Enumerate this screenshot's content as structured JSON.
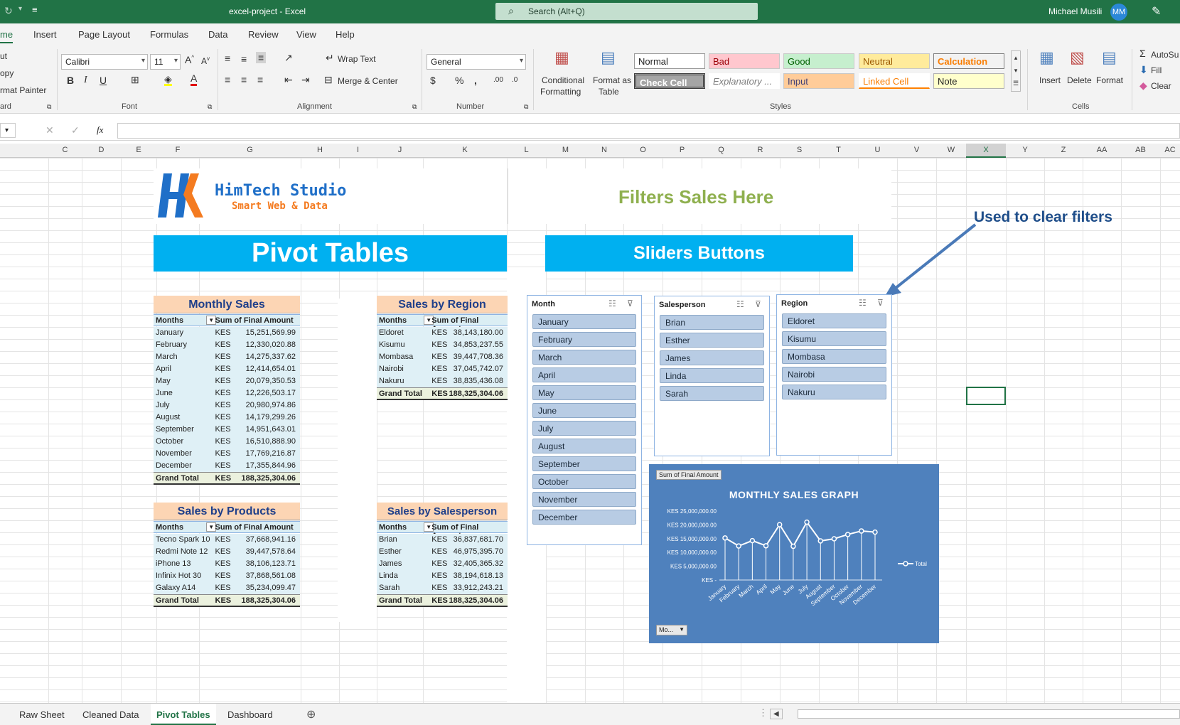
{
  "app": {
    "doc_title": "excel-project  -  Excel",
    "search_placeholder": "Search (Alt+Q)",
    "user_name": "Michael Musili",
    "user_initials": "MM"
  },
  "ribbon_tabs": [
    "me",
    "Insert",
    "Page Layout",
    "Formulas",
    "Data",
    "Review",
    "View",
    "Help"
  ],
  "ribbon": {
    "clipboard": {
      "cut": "ut",
      "copy": "opy",
      "format_painter": "rmat Painter",
      "label": "ard"
    },
    "font": {
      "name": "Calibri",
      "size": "11",
      "label": "Font"
    },
    "alignment": {
      "wrap": "Wrap Text",
      "merge": "Merge & Center",
      "label": "Alignment"
    },
    "number": {
      "format": "General",
      "label": "Number"
    },
    "styles": {
      "conditional": "Conditional",
      "conditional2": "Formatting",
      "format_as": "Format as",
      "format_as2": "Table",
      "normal": "Normal",
      "bad": "Bad",
      "good": "Good",
      "neutral": "Neutral",
      "calculation": "Calculation",
      "check_cell": "Check Cell",
      "explanatory": "Explanatory ...",
      "input": "Input",
      "linked_cell": "Linked Cell",
      "note": "Note",
      "label": "Styles"
    },
    "cells": {
      "insert": "Insert",
      "delete": "Delete",
      "format": "Format",
      "label": "Cells"
    },
    "editing": {
      "autosum": "AutoSu",
      "fill": "Fill",
      "clear": "Clear"
    }
  },
  "formula_bar": {
    "cancel": "✕",
    "enter": "✓",
    "fx": "fx",
    "content": ""
  },
  "columns": [
    "C",
    "D",
    "E",
    "F",
    "G",
    "H",
    "I",
    "J",
    "K",
    "L",
    "M",
    "N",
    "O",
    "P",
    "Q",
    "R",
    "S",
    "T",
    "U",
    "V",
    "W",
    "X",
    "Y",
    "Z",
    "AA",
    "AB",
    "AC"
  ],
  "logo": {
    "title": "HimTech Studio",
    "subtitle": "Smart Web & Data"
  },
  "filters_heading": "Filters Sales Here",
  "clear_note": "Used to clear filters",
  "pivot_banner": "Pivot Tables",
  "sliders_banner": "Sliders Buttons",
  "monthly_sales": {
    "title": "Monthly Sales",
    "col1": "Months",
    "col2": "Sum of Final Amount",
    "rows": [
      {
        "name": "January",
        "cur": "KES",
        "amt": "15,251,569.99"
      },
      {
        "name": "February",
        "cur": "KES",
        "amt": "12,330,020.88"
      },
      {
        "name": "March",
        "cur": "KES",
        "amt": "14,275,337.62"
      },
      {
        "name": "April",
        "cur": "KES",
        "amt": "12,414,654.01"
      },
      {
        "name": "May",
        "cur": "KES",
        "amt": "20,079,350.53"
      },
      {
        "name": "June",
        "cur": "KES",
        "amt": "12,226,503.17"
      },
      {
        "name": "July",
        "cur": "KES",
        "amt": "20,980,974.86"
      },
      {
        "name": "August",
        "cur": "KES",
        "amt": "14,179,299.26"
      },
      {
        "name": "September",
        "cur": "KES",
        "amt": "14,951,643.01"
      },
      {
        "name": "October",
        "cur": "KES",
        "amt": "16,510,888.90"
      },
      {
        "name": "November",
        "cur": "KES",
        "amt": "17,769,216.87"
      },
      {
        "name": "December",
        "cur": "KES",
        "amt": "17,355,844.96"
      }
    ],
    "total": {
      "name": "Grand Total",
      "cur": "KES",
      "amt": "188,325,304.06"
    }
  },
  "sales_region": {
    "title": "Sales by Region",
    "col1": "Months",
    "col2": "Sum of Final Amount",
    "rows": [
      {
        "name": "Eldoret",
        "cur": "KES",
        "amt": "38,143,180.00"
      },
      {
        "name": "Kisumu",
        "cur": "KES",
        "amt": "34,853,237.55"
      },
      {
        "name": "Mombasa",
        "cur": "KES",
        "amt": "39,447,708.36"
      },
      {
        "name": "Nairobi",
        "cur": "KES",
        "amt": "37,045,742.07"
      },
      {
        "name": "Nakuru",
        "cur": "KES",
        "amt": "38,835,436.08"
      }
    ],
    "total": {
      "name": "Grand Total",
      "cur": "KES",
      "amt": "188,325,304.06"
    }
  },
  "sales_products": {
    "title": "Sales by Products",
    "col1": "Months",
    "col2": "Sum of Final Amount",
    "rows": [
      {
        "name": "Tecno Spark 10",
        "cur": "KES",
        "amt": "37,668,941.16"
      },
      {
        "name": "Redmi Note 12",
        "cur": "KES",
        "amt": "39,447,578.64"
      },
      {
        "name": "iPhone 13",
        "cur": "KES",
        "amt": "38,106,123.71"
      },
      {
        "name": "Infinix Hot 30",
        "cur": "KES",
        "amt": "37,868,561.08"
      },
      {
        "name": "Galaxy A14",
        "cur": "KES",
        "amt": "35,234,099.47"
      }
    ],
    "total": {
      "name": "Grand Total",
      "cur": "KES",
      "amt": "188,325,304.06"
    }
  },
  "sales_salesperson": {
    "title": "Sales by Salesperson",
    "col1": "Months",
    "col2": "Sum of Final Amount",
    "rows": [
      {
        "name": "Brian",
        "cur": "KES",
        "amt": "36,837,681.70"
      },
      {
        "name": "Esther",
        "cur": "KES",
        "amt": "46,975,395.70"
      },
      {
        "name": "James",
        "cur": "KES",
        "amt": "32,405,365.32"
      },
      {
        "name": "Linda",
        "cur": "KES",
        "amt": "38,194,618.13"
      },
      {
        "name": "Sarah",
        "cur": "KES",
        "amt": "33,912,243.21"
      }
    ],
    "total": {
      "name": "Grand Total",
      "cur": "KES",
      "amt": "188,325,304.06"
    }
  },
  "slicers": {
    "month": {
      "title": "Month",
      "items": [
        "January",
        "February",
        "March",
        "April",
        "May",
        "June",
        "July",
        "August",
        "September",
        "October",
        "November",
        "December"
      ]
    },
    "salesperson": {
      "title": "Salesperson",
      "items": [
        "Brian",
        "Esther",
        "James",
        "Linda",
        "Sarah"
      ]
    },
    "region": {
      "title": "Region",
      "items": [
        "Eldoret",
        "Kisumu",
        "Mombasa",
        "Nairobi",
        "Nakuru"
      ]
    }
  },
  "chart_data": {
    "type": "line",
    "title": "MONTHLY SALES GRAPH",
    "field_button": "Sum of Final Amount",
    "axis_button": "Mo...",
    "categories": [
      "January",
      "February",
      "March",
      "April",
      "May",
      "June",
      "July",
      "August",
      "September",
      "October",
      "November",
      "December"
    ],
    "series": [
      {
        "name": "Total",
        "values": [
          15251569.99,
          12330020.88,
          14275337.62,
          12414654.01,
          20079350.53,
          12226503.17,
          20980974.86,
          14179299.26,
          14951643.01,
          16510888.9,
          17769216.87,
          17355844.96
        ]
      }
    ],
    "ytick_labels": [
      "KES 25,000,000.00",
      "KES 20,000,000.00",
      "KES 15,000,000.00",
      "KES 10,000,000.00",
      "KES 5,000,000.00",
      "KES -"
    ],
    "yticks": [
      25000000,
      20000000,
      15000000,
      10000000,
      5000000,
      0
    ],
    "ylim": [
      0,
      25000000
    ],
    "legend_position": "right",
    "grid": false,
    "colors": {
      "background": "#4f81bd",
      "line": "#ffffff"
    }
  },
  "sheet_tabs": [
    "Raw Sheet",
    "Cleaned Data",
    "Pivot Tables",
    "Dashboard"
  ],
  "active_sheet": "Pivot Tables"
}
